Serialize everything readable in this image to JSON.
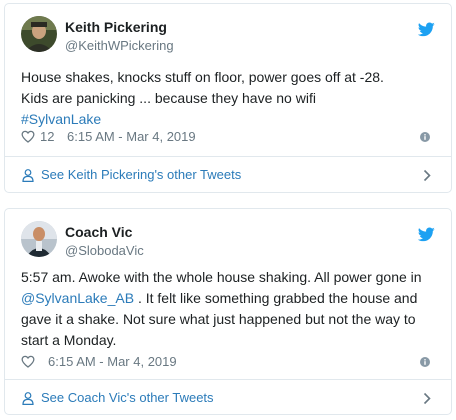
{
  "colors": {
    "text": "#1c2022",
    "secondary": "#697882",
    "link": "#2b7bb9",
    "twitter_blue": "#1da1f2",
    "border": "#e1e8ed"
  },
  "tweets": [
    {
      "author_name": "Keith Pickering",
      "author_handle": "@KeithWPickering",
      "text_line_1": "House shakes, knocks stuff on floor, power goes off at -28.",
      "text_line_2": "Kids are panicking ... because they have no wifi",
      "hashtag": "#SylvanLake",
      "like_count": "12",
      "timestamp": "6:15 AM - Mar 4, 2019",
      "footer_label": "See Keith Pickering's other Tweets",
      "icons": [
        "avatar",
        "twitter-bird-icon",
        "heart-icon",
        "info-icon",
        "person-icon",
        "chevron-right-icon"
      ]
    },
    {
      "author_name": "Coach Vic",
      "author_handle": "@SlobodaVic",
      "text_before_mention": "5:57 am. Awoke with the whole house shaking. All power gone in ",
      "mention": "@SylvanLake_AB",
      "text_after_mention": " . It felt like something grabbed the house and gave it a shake. Not sure what just happened but not the way to start a Monday.",
      "timestamp": "6:15 AM - Mar 4, 2019",
      "footer_label": "See Coach Vic's other Tweets",
      "icons": [
        "avatar",
        "twitter-bird-icon",
        "heart-icon",
        "info-icon",
        "person-icon",
        "chevron-right-icon"
      ]
    }
  ]
}
